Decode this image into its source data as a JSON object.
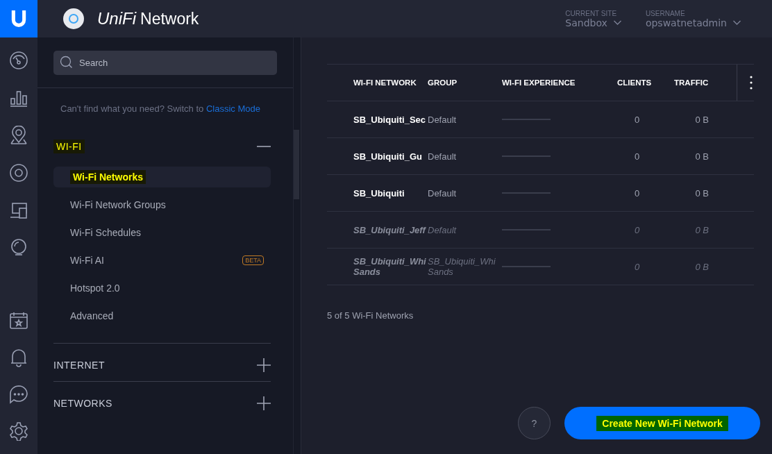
{
  "header": {
    "logo_word": "UniFi",
    "product": "Network",
    "site": {
      "label": "CURRENT SITE",
      "value": "Sandbox"
    },
    "user": {
      "label": "USERNAME",
      "value": "opswatnetadmin"
    }
  },
  "sidebar": {
    "search": {
      "placeholder": "Search"
    },
    "hint": "Can't find what you need? Switch to",
    "hint_link": "Classic Mode",
    "sections": [
      {
        "title": "WI-FI",
        "expanded": true,
        "highlighted": true,
        "items": [
          {
            "label": "Wi-Fi Networks",
            "selected": true,
            "highlighted": true
          },
          {
            "label": "Wi-Fi Network Groups",
            "selected": false,
            "highlighted": false
          },
          {
            "label": "Wi-Fi Schedules",
            "selected": false,
            "highlighted": false
          },
          {
            "label": "Wi-Fi AI",
            "selected": false,
            "highlighted": false,
            "badge": "BETA"
          },
          {
            "label": "Hotspot 2.0",
            "selected": false,
            "highlighted": false
          },
          {
            "label": "Advanced",
            "selected": false,
            "highlighted": false
          }
        ]
      },
      {
        "title": "INTERNET",
        "expanded": false,
        "highlighted": false
      },
      {
        "title": "NETWORKS",
        "expanded": false,
        "highlighted": false
      }
    ]
  },
  "table": {
    "columns": [
      "WI-FI NETWORK",
      "GROUP",
      "WI-FI EXPERIENCE",
      "CLIENTS",
      "TRAFFIC"
    ],
    "rows": [
      {
        "name": "SB_Ubiquiti_Sec",
        "group": "Default",
        "clients": "0",
        "traffic": "0 B",
        "disabled": false
      },
      {
        "name": "SB_Ubiquiti_Gu",
        "group": "Default",
        "clients": "0",
        "traffic": "0 B",
        "disabled": false
      },
      {
        "name": "SB_Ubiquiti",
        "group": "Default",
        "clients": "0",
        "traffic": "0 B",
        "disabled": false
      },
      {
        "name": "SB_Ubiquiti_Jeff",
        "group": "Default",
        "clients": "0",
        "traffic": "0 B",
        "disabled": true
      },
      {
        "name": "SB_Ubiquiti_Whi\nSands",
        "group": "SB_Ubiquiti_Whi\nSands",
        "clients": "0",
        "traffic": "0 B",
        "disabled": true
      }
    ]
  },
  "count": "5 of 5 Wi-Fi Networks",
  "help_button": "?",
  "create_button": {
    "label": "Create New Wi-Fi Network",
    "highlighted": true
  }
}
